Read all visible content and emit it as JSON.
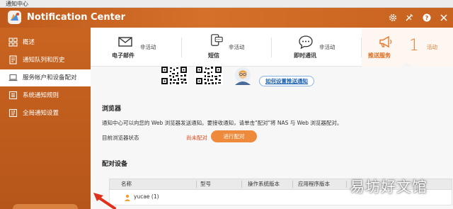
{
  "window": {
    "title": "通知中心"
  },
  "app": {
    "title": "Notification Center"
  },
  "header_icons": [
    "gear-icon",
    "tools-icon",
    "help-icon"
  ],
  "sidebar": {
    "items": [
      {
        "label": "概述",
        "icon": "overview-icon",
        "active": false
      },
      {
        "label": "通知队列和历史",
        "icon": "history-icon",
        "active": false
      },
      {
        "label": "服务帐户和设备配对",
        "icon": "laptop-icon",
        "active": true
      },
      {
        "label": "系统通知规则",
        "icon": "rules-icon",
        "active": false
      },
      {
        "label": "全局通知设置",
        "icon": "settings-icon",
        "active": false
      }
    ]
  },
  "tabs": [
    {
      "label": "电子邮件",
      "status": "非活动",
      "icon": "mail-icon"
    },
    {
      "label": "短信",
      "status": "非活动",
      "icon": "sms-icon"
    },
    {
      "label": "即时通讯",
      "status": "非活动",
      "icon": "chat-icon"
    },
    {
      "label": "推送服务",
      "status": "活动",
      "count": "1",
      "icon": "megaphone-icon",
      "active": true
    }
  ],
  "push": {
    "setup_link": "如何设置推送通知"
  },
  "browser": {
    "title": "浏览器",
    "description": "通知中心可以向您的 Web 浏览器发送通知。要接收通知，请单击\"配对\"将 NAS 与 Web 浏览器配对。",
    "state_label": "目前浏览器状态",
    "state_value": "尚未配对",
    "pair_button": "进行配对"
  },
  "paired": {
    "title": "配对设备",
    "columns": [
      "名称",
      "型号",
      "操作系统版本",
      "应用程序版本"
    ],
    "group_label": "yucae (1)"
  },
  "watermark": "易坊好文馆",
  "colors": {
    "accent": "#e47a2e",
    "sidebar": "#c96420",
    "link": "#1a5fb4",
    "warning": "#e0471a"
  }
}
